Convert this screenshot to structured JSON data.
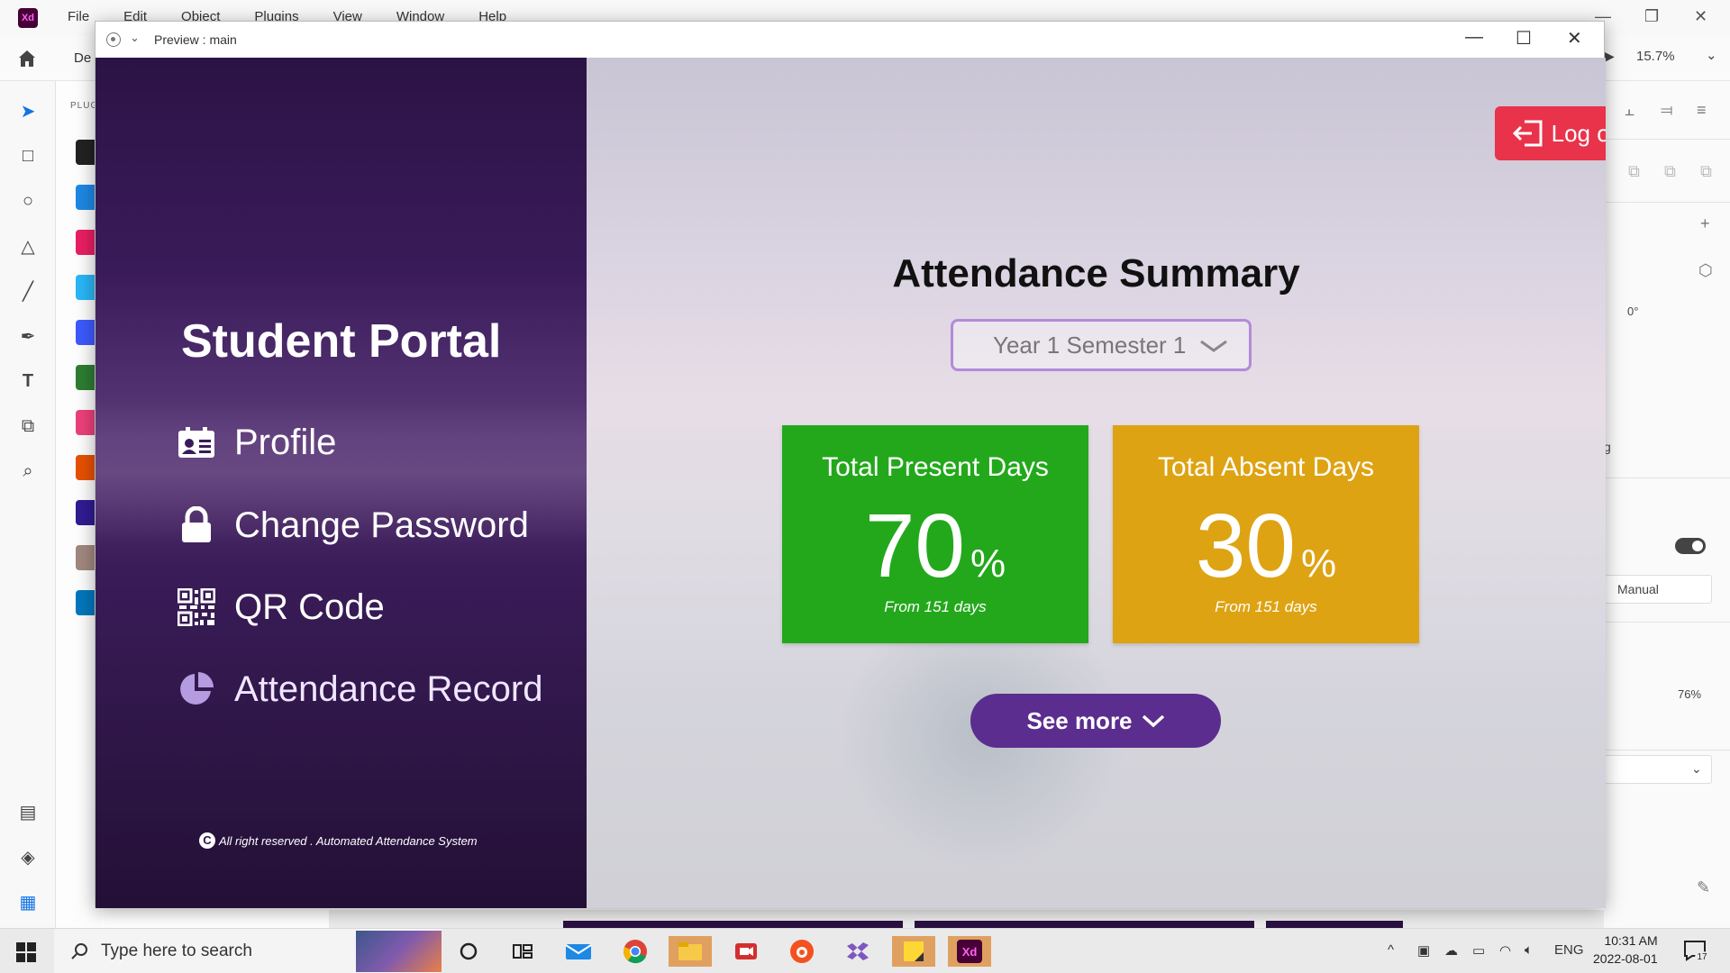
{
  "app": {
    "logo": "Xd",
    "menu": [
      "File",
      "Edit",
      "Object",
      "Plugins",
      "View",
      "Window",
      "Help"
    ],
    "design_tab_partial": "De",
    "plugins_label_partial": "PLUG",
    "zoom": "15.7%",
    "rotation": "0°",
    "right_partial_text": "g",
    "field_manual": "Manual",
    "percent_76": "76%"
  },
  "preview": {
    "title": "Preview : main",
    "left": {
      "portal_title": "Student Portal",
      "nav": [
        {
          "label": "Profile",
          "icon": "id-card-icon"
        },
        {
          "label": "Change Password",
          "icon": "lock-icon"
        },
        {
          "label": "QR Code",
          "icon": "qr-code-icon"
        },
        {
          "label": "Attendance Record",
          "icon": "pie-chart-icon"
        }
      ],
      "footer": "All right reserved . Automated Attendance System",
      "footer_symbol": "C"
    },
    "main": {
      "logout_label": "Log out",
      "title": "Attendance Summary",
      "semester": "Year 1 Semester 1",
      "cards": [
        {
          "label": "Total Present Days",
          "value": "70",
          "unit": "%",
          "sub": "From 151 days",
          "color": "#23a81c"
        },
        {
          "label": "Total Absent Days",
          "value": "30",
          "unit": "%",
          "sub": "From 151 days",
          "color": "#dea313"
        }
      ],
      "see_more_label": "See more"
    }
  },
  "taskbar": {
    "search_placeholder": "Type here to search",
    "language": "ENG",
    "time": "10:31 AM",
    "date": "2022-08-01",
    "notifications": "17"
  },
  "colors": {
    "accent_purple": "#5b2d8e",
    "logout_red": "#e8334a",
    "select_border": "#b28bd8"
  }
}
